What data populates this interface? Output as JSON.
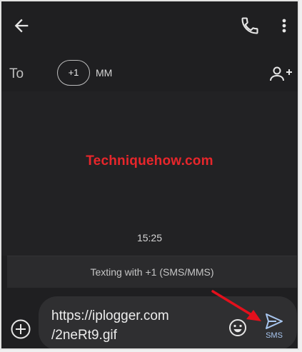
{
  "header": {
    "back_icon": "arrow-back-icon",
    "call_icon": "phone-icon",
    "menu_icon": "more-vert-icon"
  },
  "recipient": {
    "to_label": "To",
    "chip_text": "+1",
    "chip_name": "MM",
    "add_icon": "person-add-icon"
  },
  "conversation": {
    "watermark": "Techniquehow.com",
    "timestamp": "15:25",
    "texting_notice": "Texting with +1 (SMS/MMS)"
  },
  "composer": {
    "message_text": "https://iplogger.com\n/2neRt9.gif",
    "attach_icon": "add-circle-icon",
    "emoji_icon": "emoji-icon",
    "send_icon": "send-icon",
    "send_label": "SMS"
  },
  "colors": {
    "background": "#1f1f21",
    "watermark": "#e8262b",
    "send_accent": "#a8c6ef",
    "annotation_arrow": "#e3101c"
  }
}
